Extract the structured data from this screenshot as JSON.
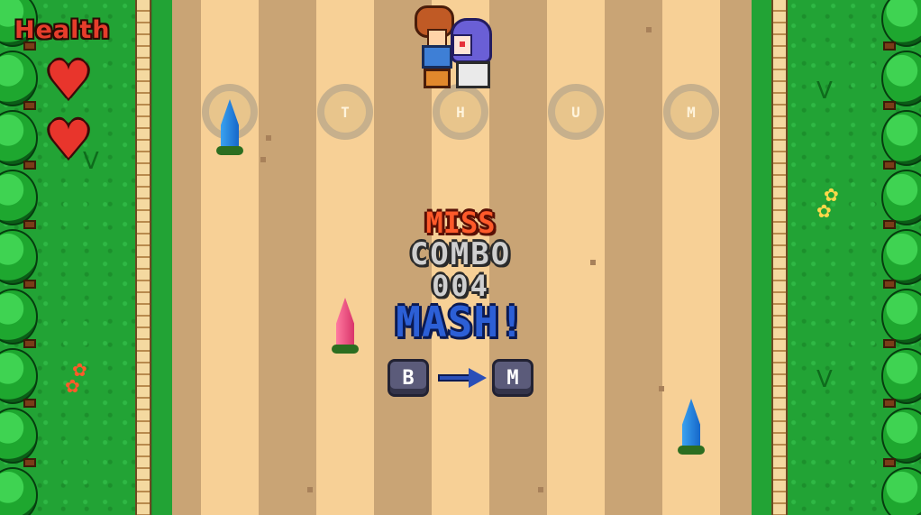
{
  "hud": {
    "health_label": "Health",
    "hearts": 2
  },
  "lanes": {
    "rings": [
      "",
      "T",
      "H",
      "U",
      "M"
    ]
  },
  "notes": [
    {
      "lane": 1,
      "color": "blue"
    },
    {
      "lane": 2,
      "color": "pink"
    },
    {
      "lane": 5,
      "color": "blue"
    }
  ],
  "feedback": {
    "judgement": "MISS",
    "combo_label": "COMBO",
    "combo_count": "004",
    "prompt": "MASH!"
  },
  "mash_prompt": {
    "from_key": "B",
    "to_key": "M"
  },
  "colors": {
    "grass": "#22a335",
    "road_light": "#f7d096",
    "road_dark": "#c9a475",
    "miss": "#ff5a2a",
    "mash": "#2c5fd6",
    "heart": "#e8352c"
  },
  "icons": {
    "heart": "heart-icon",
    "arrow": "arrow-right-icon"
  }
}
